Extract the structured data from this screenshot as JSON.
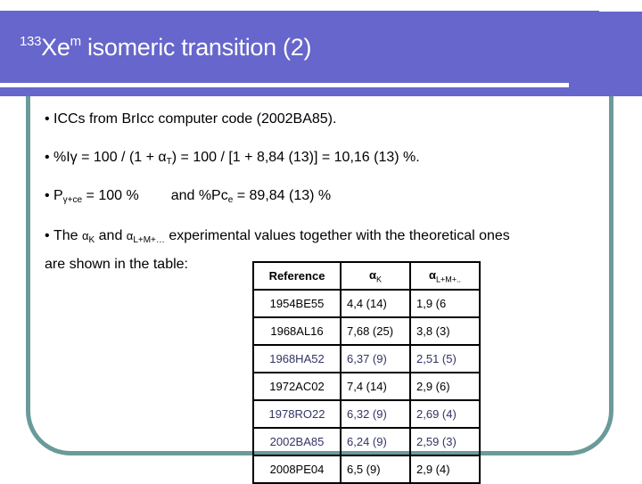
{
  "title": {
    "superscript": "133",
    "element": "Xe",
    "isomer_mark": "m",
    "rest": " isomeric transition (2)"
  },
  "bullets": {
    "b1": "ICCs from BrIcc computer code (2002BA85).",
    "b2_pre": "%Iγ = 100 / (1 + α",
    "b2_sub": "T",
    "b2_post": ") = 100 / [1 + 8,84 (13)] = 10,16 (13) %.",
    "b3_pre": "P",
    "b3_sub": "γ+ce",
    "b3_mid": " = 100 %",
    "b3_and": "and %Pc",
    "b3_sub2": "e",
    "b3_post": " = 89,84 (13) %",
    "b4_pre": "The ",
    "b4_alpha1": "α",
    "b4_sub1": "K",
    "b4_and": " and ",
    "b4_alpha2": "α",
    "b4_sub2": "L+M+…",
    "b4_post": " experimental values together with the theoretical ones",
    "b4_line2": "are shown in the table:"
  },
  "bullet_glyph": "•",
  "table": {
    "headers": [
      {
        "label": "Reference",
        "sub": ""
      },
      {
        "label": "α",
        "sub": "K"
      },
      {
        "label": "α",
        "sub": "L+M+.."
      }
    ],
    "rows": [
      [
        "1954BE55",
        "4,4 (14)",
        "1,9 (6"
      ],
      [
        "1968AL16",
        "7,68 (25)",
        "3,8 (3)"
      ],
      [
        "1968HA52",
        "6,37 (9)",
        "2,51 (5)"
      ],
      [
        "1972AC02",
        "7,4 (14)",
        "2,9 (6)"
      ],
      [
        "1978RO22",
        "6,32 (9)",
        "2,69 (4)"
      ],
      [
        "2002BA85",
        "6,24 (9)",
        "2,59 (3)"
      ],
      [
        "2008PE04",
        "6,5 (9)",
        "2,9 (4)"
      ]
    ]
  },
  "colors": {
    "banner": "#6666cc",
    "frame": "#6a9a9a",
    "title_text": "#ffffff"
  }
}
